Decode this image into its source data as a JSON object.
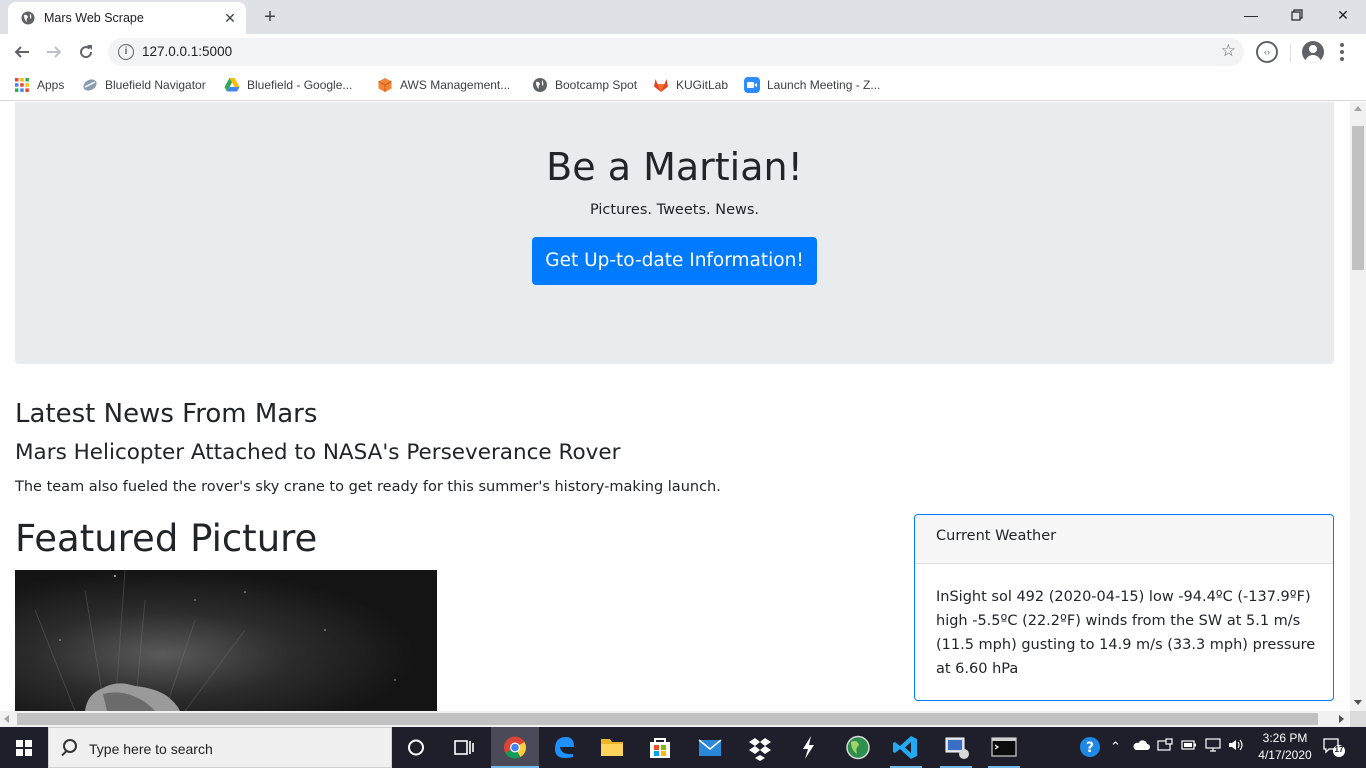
{
  "browser": {
    "tab_title": "Mars Web Scrape",
    "url": "127.0.0.1:5000",
    "bookmarks": [
      {
        "label": "Apps",
        "icon": "apps-grid-icon"
      },
      {
        "label": "Bluefield Navigator",
        "icon": "navigator-icon"
      },
      {
        "label": "Bluefield - Google...",
        "icon": "google-drive-icon"
      },
      {
        "label": "AWS Management...",
        "icon": "aws-icon"
      },
      {
        "label": "Bootcamp Spot",
        "icon": "globe-icon"
      },
      {
        "label": "KUGitLab",
        "icon": "gitlab-icon"
      },
      {
        "label": "Launch Meeting - Z...",
        "icon": "zoom-icon"
      }
    ]
  },
  "page": {
    "jumbotron": {
      "title": "Be a Martian!",
      "subtitle": "Pictures. Tweets. News.",
      "button_label": "Get Up-to-date Information!"
    },
    "news": {
      "heading": "Latest News From Mars",
      "title": "Mars Helicopter Attached to NASA's Perseverance Rover",
      "paragraph": "The team also fueled the rover's sky crane to get ready for this summer's history-making launch."
    },
    "featured": {
      "heading": "Featured Picture"
    },
    "weather": {
      "header": "Current Weather",
      "body": "InSight sol 492 (2020-04-15) low -94.4ºC (-137.9ºF) high -5.5ºC (22.2ºF) winds from the SW at 5.1 m/s (11.5 mph) gusting to 14.9 m/s (33.3 mph) pressure at 6.60 hPa"
    }
  },
  "taskbar": {
    "search_placeholder": "Type here to search",
    "time": "3:26 PM",
    "date": "4/17/2020",
    "notifications": "17"
  },
  "colors": {
    "accent": "#007bff",
    "jumbotron_bg": "#e9ecef",
    "taskbar_bg": "#1f1f2b"
  }
}
